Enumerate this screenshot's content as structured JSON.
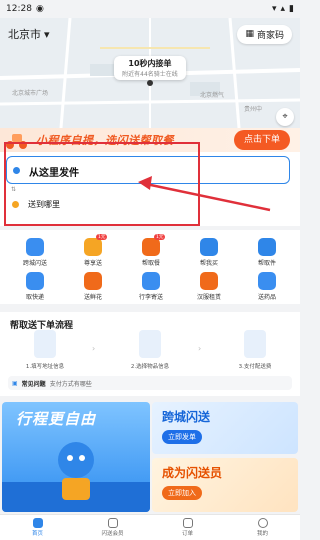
{
  "status_bar": {
    "time": "12:28"
  },
  "header": {
    "city": "北京市",
    "merchant_code": "商家码"
  },
  "map": {
    "pin_title": "10秒内接单",
    "pin_subtitle": "附近有44名骑士在线",
    "labels": [
      "北京城市广场",
      "北京燃气",
      "贵州中"
    ]
  },
  "promo": {
    "slogan": "小程序自提，选闪送帮取餐",
    "cta": "点击下单"
  },
  "address": {
    "send_from": "从这里发件",
    "send_to": "送到哪里"
  },
  "services": [
    {
      "label": "跨城闪送",
      "color": "#3a8ef0"
    },
    {
      "label": "尊享送",
      "color": "#f5a524",
      "tag": "1元"
    },
    {
      "label": "帮取餐",
      "color": "#f06a1a",
      "tag": "1元"
    },
    {
      "label": "帮我买",
      "color": "#2f86e8"
    },
    {
      "label": "帮取件",
      "color": "#2f86e8"
    },
    {
      "label": "取快递",
      "color": "#3a8ef0"
    },
    {
      "label": "送鲜花",
      "color": "#f06a1a"
    },
    {
      "label": "行李寄送",
      "color": "#3a8ef0"
    },
    {
      "label": "汉服租赁",
      "color": "#f06a1a"
    },
    {
      "label": "送药品",
      "color": "#3a8ef0"
    }
  ],
  "process": {
    "title": "帮取送下单流程",
    "steps": [
      "1.填写地址信息",
      "2.选择物品信息",
      "3.支付配送费"
    ],
    "faq_title": "常见问题",
    "faq_text": "支付方式有哪些"
  },
  "banners": {
    "left_title": "行程更自由",
    "right_top_title": "跨城闪送",
    "right_top_button": "立即发单",
    "right_bottom_title": "成为闪送员",
    "right_bottom_button": "立即加入"
  },
  "tabs": [
    "首页",
    "闪送会员",
    "订单",
    "我的"
  ]
}
